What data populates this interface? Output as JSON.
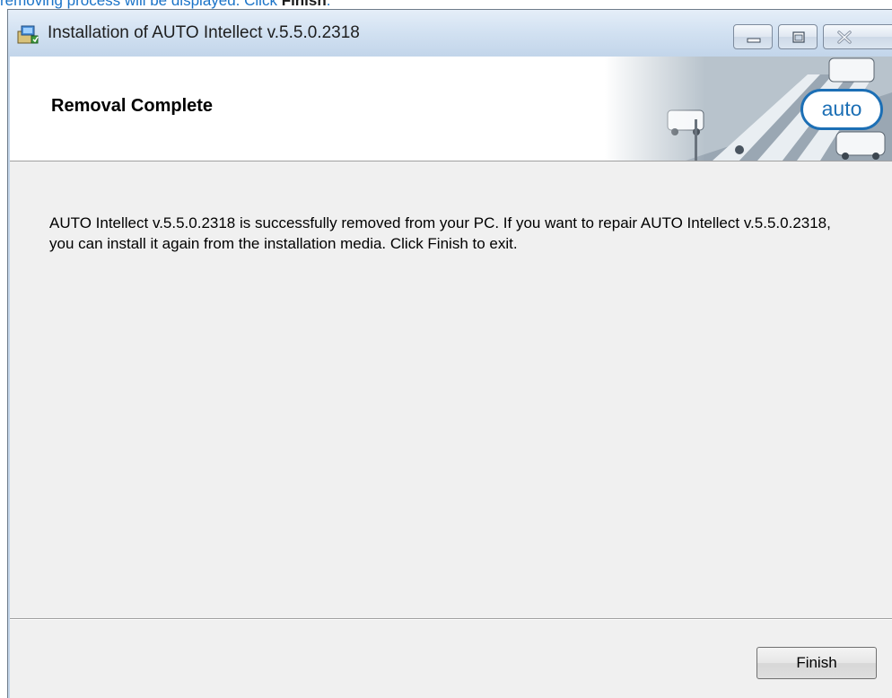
{
  "caption": {
    "prefix": "removing process will be displayed. Click ",
    "bold": "Finish",
    "suffix": "."
  },
  "window": {
    "title": "Installation of AUTO Intellect v.5.5.0.2318",
    "controls": {
      "minimize": "minimize-icon",
      "maximize": "maximize-icon",
      "close": "close-icon"
    }
  },
  "banner": {
    "title": "Removal Complete",
    "logo": "auto"
  },
  "message": "AUTO Intellect v.5.5.0.2318 is successfully removed from your PC. If you want to repair AUTO Intellect v.5.5.0.2318, you can install it again from the installation media. Click Finish to exit.",
  "buttons": {
    "finish": "Finish"
  },
  "colors": {
    "link": "#1a73c8",
    "logo": "#1c6fb5",
    "titlebar": "#d3e2f2",
    "dialog_bg": "#f0f0f0"
  }
}
